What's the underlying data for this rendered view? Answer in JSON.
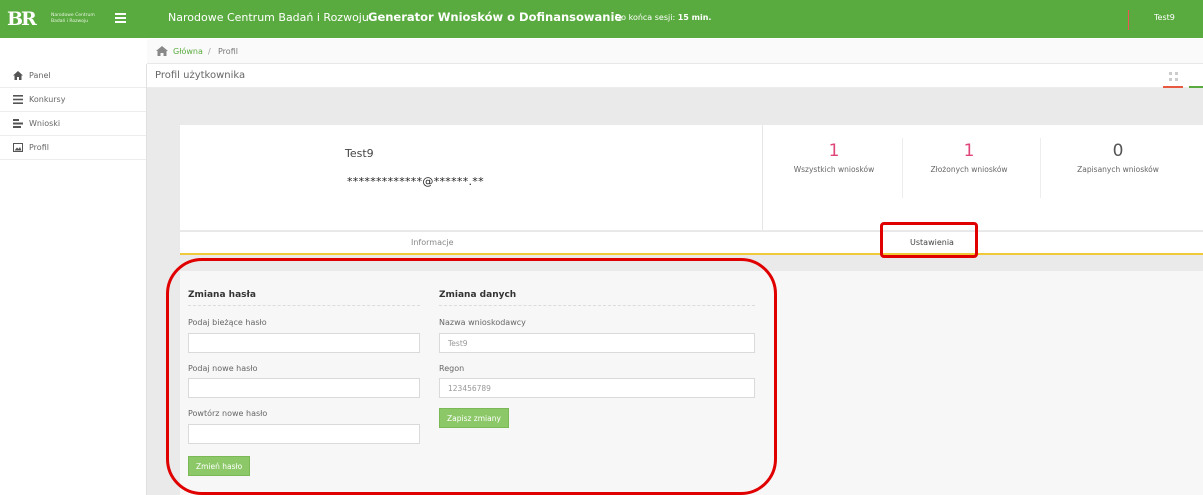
{
  "header": {
    "logo_mark": "BR",
    "logo_text_line1": "Narodowe Centrum",
    "logo_text_line2": "Badań i Rozwoju",
    "organization": "Narodowe Centrum Badań i Rozwoju",
    "app_title": "Generator Wniosków o Dofinansowanie",
    "session_label": "Do końca sesji:",
    "session_value": "15 min.",
    "user": "Test9"
  },
  "breadcrumb": {
    "home": "Główna",
    "separator": "/",
    "current": "Profil"
  },
  "sidebar": {
    "items": [
      {
        "label": "Panel",
        "icon": "home-icon"
      },
      {
        "label": "Konkursy",
        "icon": "list-icon"
      },
      {
        "label": "Wnioski",
        "icon": "documents-icon"
      },
      {
        "label": "Profil",
        "icon": "image-icon"
      }
    ]
  },
  "page": {
    "title": "Profil użytkownika"
  },
  "profile": {
    "name": "Test9",
    "email": "*************@******.**"
  },
  "stats": [
    {
      "value": "1",
      "label": "Wszystkich wniosków"
    },
    {
      "value": "1",
      "label": "Złożonych wniosków"
    },
    {
      "value": "0",
      "label": "Zapisanych wniosków"
    }
  ],
  "tabs": {
    "info": "Informacje",
    "settings": "Ustawienia"
  },
  "password_form": {
    "title": "Zmiana hasła",
    "current_label": "Podaj bieżące hasło",
    "current_value": "",
    "new_label": "Podaj nowe hasło",
    "new_value": "",
    "repeat_label": "Powtórz nowe hasło",
    "repeat_value": "",
    "submit": "Zmień hasło"
  },
  "data_form": {
    "title": "Zmiana danych",
    "name_label": "Nazwa wnioskodawcy",
    "name_value": "Test9",
    "regon_label": "Regon",
    "regon_value": "123456789",
    "submit": "Zapisz zmiany"
  },
  "colors": {
    "brand_green": "#5aab3f",
    "button_green": "#8cc868",
    "stat_pink": "#e0457a",
    "tab_underline": "#f0c93a",
    "annotation_red": "#e00000"
  }
}
